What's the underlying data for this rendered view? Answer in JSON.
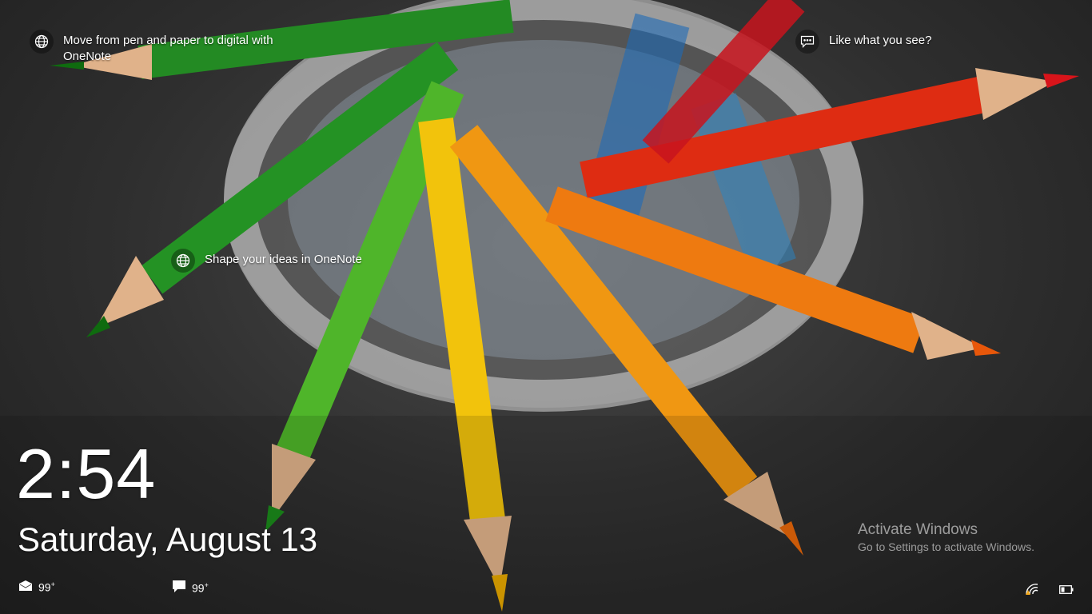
{
  "spotlight": {
    "top_left_text": "Move from pen and paper to digital with OneNote",
    "top_right_text": "Like what you see?",
    "middle_text": "Shape your ideas in OneNote"
  },
  "lockscreen": {
    "time": "2:54",
    "date": "Saturday, August 13"
  },
  "notifications": {
    "mail_count": "99",
    "mail_suffix": "+",
    "messages_count": "99",
    "messages_suffix": "+"
  },
  "watermark": {
    "title": "Activate Windows",
    "subtitle": "Go to Settings to activate Windows."
  },
  "icons": {
    "globe": "globe-icon",
    "chat": "chat-icon",
    "mail": "mail-icon",
    "message": "message-icon",
    "network": "network-icon",
    "battery": "battery-icon"
  },
  "colors": {
    "pencil_green": "#2e9e2e",
    "pencil_red": "#d8281e",
    "pencil_orange": "#f08a12",
    "pencil_yellow": "#f2c30c",
    "background": "#2f2f2f"
  }
}
